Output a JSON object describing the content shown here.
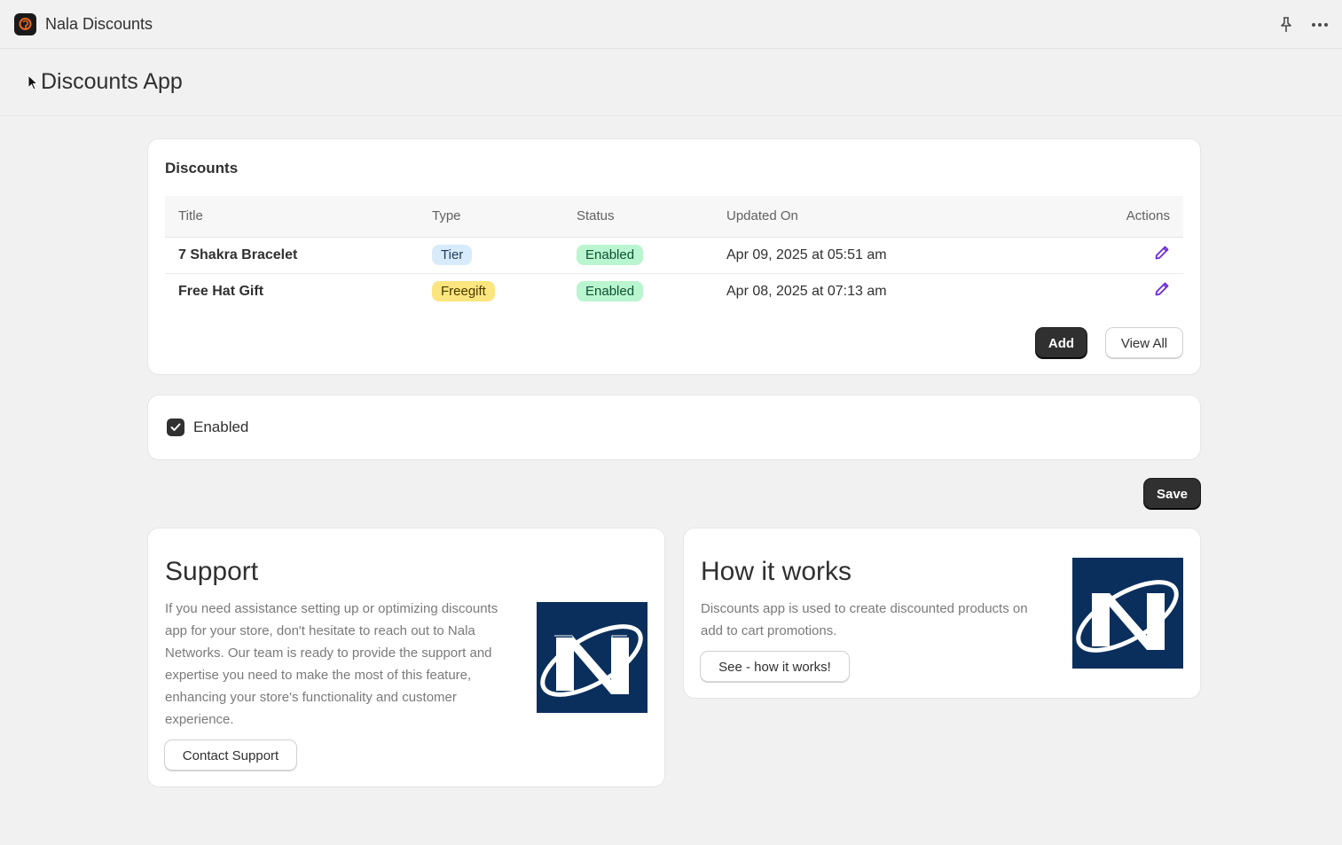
{
  "topbar": {
    "app_name": "Nala Discounts",
    "pin_icon": "pin-icon",
    "more_icon": "more-horizontal-icon"
  },
  "page": {
    "title": "Discounts App"
  },
  "discounts": {
    "title": "Discounts",
    "columns": [
      "Title",
      "Type",
      "Status",
      "Updated On",
      "Actions"
    ],
    "rows": [
      {
        "title": "7 Shakra Bracelet",
        "type": "Tier",
        "status": "Enabled",
        "updated": "Apr 09, 2025 at 05:51 am"
      },
      {
        "title": "Free Hat Gift",
        "type": "Freegift",
        "status": "Enabled",
        "updated": "Apr 08, 2025 at 07:13 am"
      }
    ],
    "add_label": "Add",
    "view_all_label": "View All"
  },
  "settings": {
    "enabled_label": "Enabled",
    "enabled_checked": true,
    "save_label": "Save"
  },
  "support": {
    "title": "Support",
    "text": "If you need assistance setting up or optimizing discounts app for your store, don't hesitate to reach out to Nala Networks. Our team is ready to provide the support and expertise you need to make the most of this feature, enhancing your store's functionality and customer experience.",
    "button_label": "Contact Support"
  },
  "how_it_works": {
    "title": "How it works",
    "text": "Discounts app is used to create discounted products on add to cart promotions.",
    "button_label": "See - how it works!"
  },
  "colors": {
    "primary_button": "#303030",
    "badge_tier": "#d8ebfb",
    "badge_freegift": "#fbe57e",
    "badge_enabled": "#b9f5cf",
    "edit_icon": "#6d28d9",
    "brand_tile": "#0a2f5c"
  }
}
